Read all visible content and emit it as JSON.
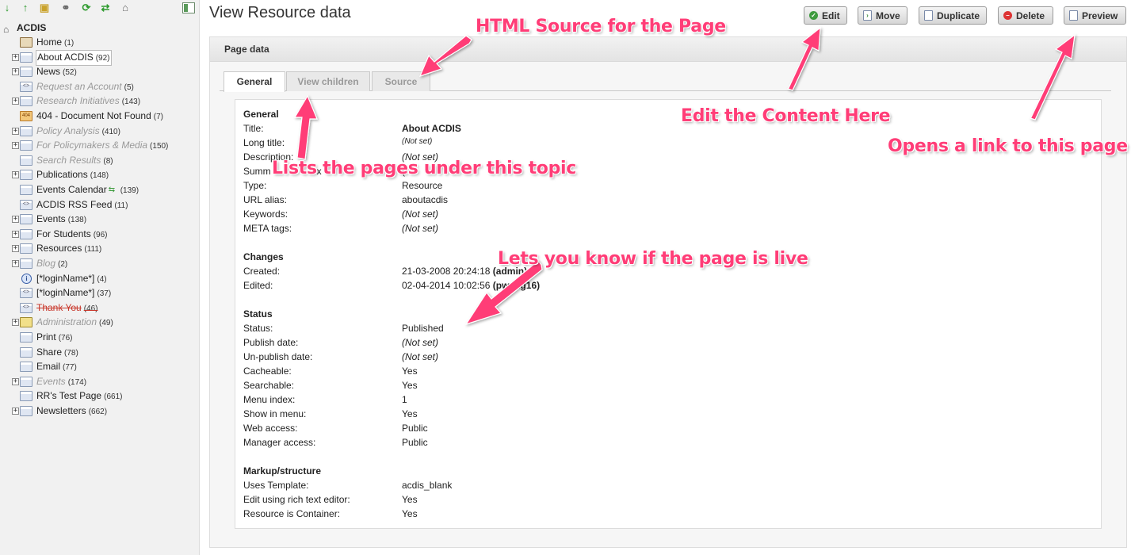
{
  "sidebar": {
    "root_label": "ACDIS",
    "items": [
      {
        "label": "Home",
        "count": "(1)",
        "expand": false,
        "icon": "home",
        "state": "normal"
      },
      {
        "label": "About ACDIS",
        "count": "(92)",
        "expand": true,
        "icon": "page",
        "state": "selected"
      },
      {
        "label": "News",
        "count": "(52)",
        "expand": true,
        "icon": "page",
        "state": "normal"
      },
      {
        "label": "Request an Account",
        "count": "(5)",
        "expand": false,
        "icon": "code",
        "state": "unpublished"
      },
      {
        "label": "Research Initiatives",
        "count": "(143)",
        "expand": true,
        "icon": "page",
        "state": "unpublished"
      },
      {
        "label": "404 - Document Not Found",
        "count": "(7)",
        "expand": false,
        "icon": "404",
        "state": "normal"
      },
      {
        "label": "Policy Analysis",
        "count": "(410)",
        "expand": true,
        "icon": "page",
        "state": "unpublished"
      },
      {
        "label": "For Policymakers & Media",
        "count": "(150)",
        "expand": true,
        "icon": "page",
        "state": "unpublished"
      },
      {
        "label": "Search Results",
        "count": "(8)",
        "expand": false,
        "icon": "page",
        "state": "unpublished"
      },
      {
        "label": "Publications",
        "count": "(148)",
        "expand": true,
        "icon": "page",
        "state": "normal"
      },
      {
        "label": "Events Calendar",
        "count": "(139)",
        "expand": false,
        "icon": "page",
        "state": "normal",
        "extra_icon": true
      },
      {
        "label": "ACDIS RSS Feed",
        "count": "(11)",
        "expand": false,
        "icon": "code",
        "state": "normal"
      },
      {
        "label": "Events",
        "count": "(138)",
        "expand": true,
        "icon": "page",
        "state": "normal"
      },
      {
        "label": "For Students",
        "count": "(96)",
        "expand": true,
        "icon": "page",
        "state": "normal"
      },
      {
        "label": "Resources",
        "count": "(111)",
        "expand": true,
        "icon": "page",
        "state": "normal"
      },
      {
        "label": "Blog",
        "count": "(2)",
        "expand": true,
        "icon": "page",
        "state": "unpublished"
      },
      {
        "label": "[*loginName*]",
        "count": "(4)",
        "expand": false,
        "icon": "info",
        "state": "normal"
      },
      {
        "label": "[*loginName*]",
        "count": "(37)",
        "expand": false,
        "icon": "code",
        "state": "normal"
      },
      {
        "label": "Thank You",
        "count": "(46)",
        "expand": false,
        "icon": "code",
        "state": "deleted"
      },
      {
        "label": "Administration",
        "count": "(49)",
        "expand": true,
        "icon": "admin",
        "state": "unpublished"
      },
      {
        "label": "Print",
        "count": "(76)",
        "expand": false,
        "icon": "page",
        "state": "normal"
      },
      {
        "label": "Share",
        "count": "(78)",
        "expand": false,
        "icon": "page",
        "state": "normal"
      },
      {
        "label": "Email",
        "count": "(77)",
        "expand": false,
        "icon": "page",
        "state": "normal"
      },
      {
        "label": "Events",
        "count": "(174)",
        "expand": true,
        "icon": "page",
        "state": "unpublished"
      },
      {
        "label": "RR's Test Page",
        "count": "(661)",
        "expand": false,
        "icon": "page",
        "state": "normal"
      },
      {
        "label": "Newsletters",
        "count": "(662)",
        "expand": true,
        "icon": "page",
        "state": "normal"
      }
    ]
  },
  "header": {
    "title": "View Resource data",
    "buttons": {
      "edit": "Edit",
      "move": "Move",
      "duplicate": "Duplicate",
      "delete": "Delete",
      "preview": "Preview"
    }
  },
  "panel": {
    "title": "Page data",
    "tabs": {
      "general": "General",
      "children": "View children",
      "source": "Source"
    }
  },
  "sections": {
    "general": {
      "heading": "General",
      "title_label": "Title:",
      "title_value": "About ACDIS",
      "longtitle_label": "Long title:",
      "longtitle_value": "(Not set)",
      "description_label": "Description:",
      "description_value": "(Not set)",
      "summary_label": "Summ",
      "summary_tail": "x",
      "summary_value": "(",
      "type_label": "Type:",
      "type_value": "Resource",
      "alias_label": "URL alias:",
      "alias_value": "aboutacdis",
      "keywords_label": "Keywords:",
      "keywords_value": "(Not set)",
      "meta_label": "META tags:",
      "meta_value": "(Not set)"
    },
    "changes": {
      "heading": "Changes",
      "created_label": "Created:",
      "created_value": "21-03-2008 20:24:18",
      "created_by": "(admin)",
      "edited_label": "Edited:",
      "edited_value": "02-04-2014 10:02:56",
      "edited_by": "(pwang16)"
    },
    "status": {
      "heading": "Status",
      "status_label": "Status:",
      "status_value": "Published",
      "publish_label": "Publish date:",
      "publish_value": "(Not set)",
      "unpublish_label": "Un-publish date:",
      "unpublish_value": "(Not set)",
      "cacheable_label": "Cacheable:",
      "cacheable_value": "Yes",
      "searchable_label": "Searchable:",
      "searchable_value": "Yes",
      "menuindex_label": "Menu index:",
      "menuindex_value": "1",
      "showmenu_label": "Show in menu:",
      "showmenu_value": "Yes",
      "webaccess_label": "Web access:",
      "webaccess_value": "Public",
      "mgraccess_label": "Manager access:",
      "mgraccess_value": "Public"
    },
    "markup": {
      "heading": "Markup/structure",
      "template_label": "Uses Template:",
      "template_value": "acdis_blank",
      "richtext_label": "Edit using rich text editor:",
      "richtext_value": "Yes",
      "container_label": "Resource is Container:",
      "container_value": "Yes"
    }
  },
  "annotations": {
    "source": "HTML Source for the Page",
    "edit": "Edit the Content Here",
    "preview": "Opens a link to this page",
    "children": "Lists the pages under this topic",
    "status": "Lets you know if the page is live"
  },
  "colors": {
    "annotation": "#ff3d77",
    "published_green": "#3f9b3f",
    "delete_red": "#d33"
  }
}
